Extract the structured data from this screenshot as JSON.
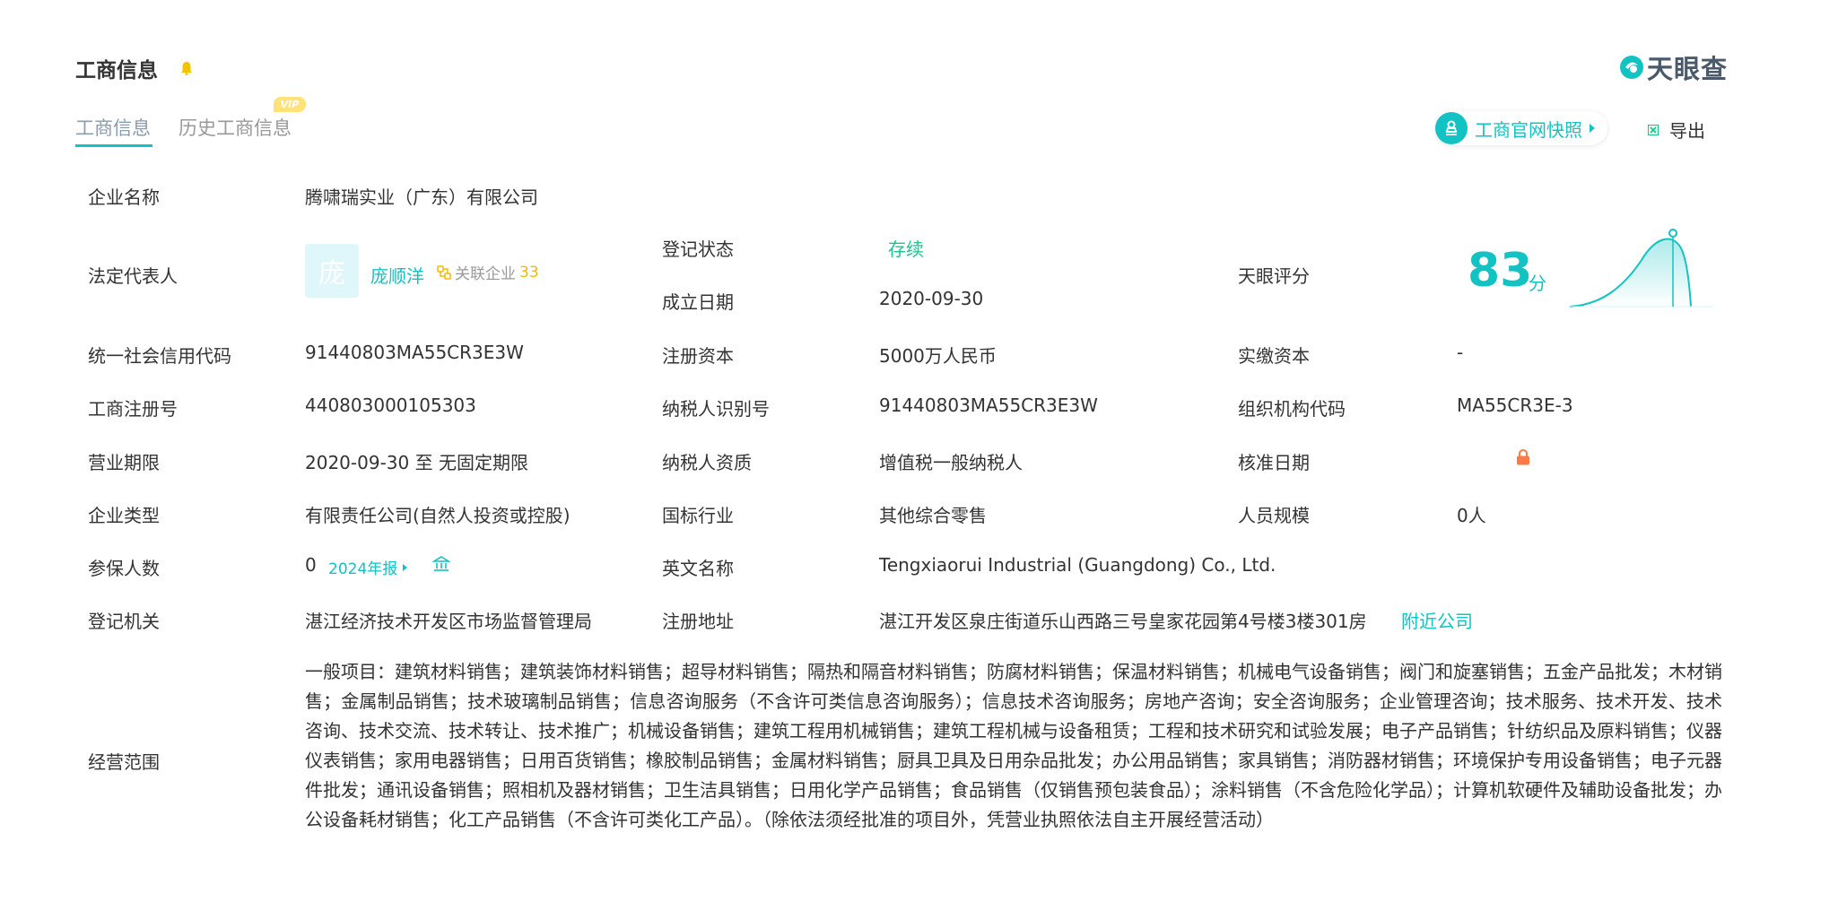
{
  "header": {
    "title": "工商信息",
    "brand": "天眼查"
  },
  "tabs": [
    {
      "label": "工商信息",
      "active": true
    },
    {
      "label": "历史工商信息",
      "active": false,
      "badge": "VIP"
    }
  ],
  "actions": {
    "snapshot_label": "工商官网快照",
    "export_label": "导出"
  },
  "fields": {
    "company_name_label": "企业名称",
    "company_name": "腾啸瑞实业（广东）有限公司",
    "legal_rep_label": "法定代表人",
    "legal_rep_avatar": "庞",
    "legal_rep_name": "庞顺洋",
    "related_label": "关联企业",
    "related_count": "33",
    "reg_status_label": "登记状态",
    "reg_status": "存续",
    "found_date_label": "成立日期",
    "found_date": "2020-09-30",
    "tianyan_score_label": "天眼评分",
    "score": "83",
    "score_unit": "分",
    "credit_code_label": "统一社会信用代码",
    "credit_code": "91440803MA55CR3E3W",
    "reg_capital_label": "注册资本",
    "reg_capital": "5000万人民币",
    "paid_capital_label": "实缴资本",
    "paid_capital": "-",
    "reg_number_label": "工商注册号",
    "reg_number": "440803000105303",
    "taxpayer_id_label": "纳税人识别号",
    "taxpayer_id": "91440803MA55CR3E3W",
    "org_code_label": "组织机构代码",
    "org_code": "MA55CR3E-3",
    "biz_term_label": "营业期限",
    "biz_term": "2020-09-30 至 无固定期限",
    "taxpayer_qual_label": "纳税人资质",
    "taxpayer_qual": "增值税一般纳税人",
    "approval_date_label": "核准日期",
    "company_type_label": "企业类型",
    "company_type": "有限责任公司(自然人投资或控股)",
    "industry_label": "国标行业",
    "industry": "其他综合零售",
    "staff_size_label": "人员规模",
    "staff_size": "0人",
    "insured_label": "参保人数",
    "insured": "0",
    "annual_report": "2024年报",
    "english_name_label": "英文名称",
    "english_name": "Tengxiaorui Industrial (Guangdong) Co., Ltd.",
    "reg_authority_label": "登记机关",
    "reg_authority": "湛江经济技术开发区市场监督管理局",
    "reg_address_label": "注册地址",
    "reg_address": "湛江开发区泉庄街道乐山西路三号皇家花园第4号楼3楼301房",
    "nearby_label": "附近公司",
    "scope_label": "经营范围",
    "scope": "一般项目：建筑材料销售；建筑装饰材料销售；超导材料销售；隔热和隔音材料销售；防腐材料销售；保温材料销售；机械电气设备销售；阀门和旋塞销售；五金产品批发；木材销售；金属制品销售；技术玻璃制品销售；信息咨询服务（不含许可类信息咨询服务）；信息技术咨询服务；房地产咨询；安全咨询服务；企业管理咨询；技术服务、技术开发、技术咨询、技术交流、技术转让、技术推广；机械设备销售；建筑工程用机械销售；建筑工程机械与设备租赁；工程和技术研究和试验发展；电子产品销售；针纺织品及原料销售；仪器仪表销售；家用电器销售；日用百货销售；橡胶制品销售；金属材料销售；厨具卫具及日用杂品批发；办公用品销售；家具销售；消防器材销售；环境保护专用设备销售；电子元器件批发；通讯设备销售；照相机及器材销售；卫生洁具销售；日用化学产品销售；食品销售（仅销售预包装食品）；涂料销售（不含危险化学品）；计算机软硬件及辅助设备批发；办公设备耗材销售；化工产品销售（不含许可类化工产品）。（除依法须经批准的项目外，凭营业执照依法自主开展经营活动）"
  },
  "colors": {
    "accent": "#13c2c2",
    "status_green": "#19c48a",
    "vip_yellow": "#ffe27a",
    "lock_orange": "#ff7a45"
  }
}
